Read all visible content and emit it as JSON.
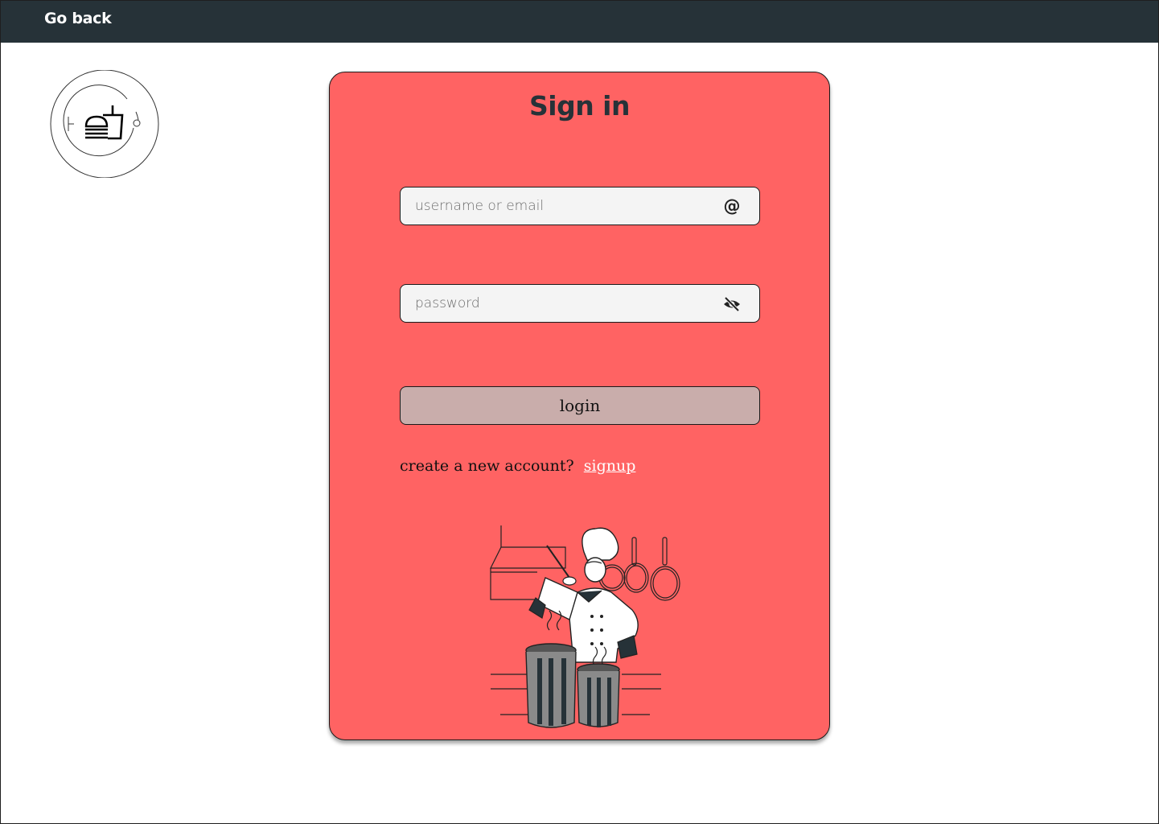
{
  "header": {
    "back_label": "Go back"
  },
  "card": {
    "title": "Sign in",
    "username": {
      "placeholder": "username or email",
      "icon": "at-icon"
    },
    "password": {
      "placeholder": "password",
      "icon": "eye-slash-icon"
    },
    "login_label": "login",
    "signup_prompt": "create a new account?",
    "signup_label": "signup"
  },
  "colors": {
    "header_bg": "#263238",
    "card_bg": "#ff6363",
    "field_bg": "#f4f4f4",
    "button_bg": "#c9adab",
    "title_color": "#263238"
  }
}
